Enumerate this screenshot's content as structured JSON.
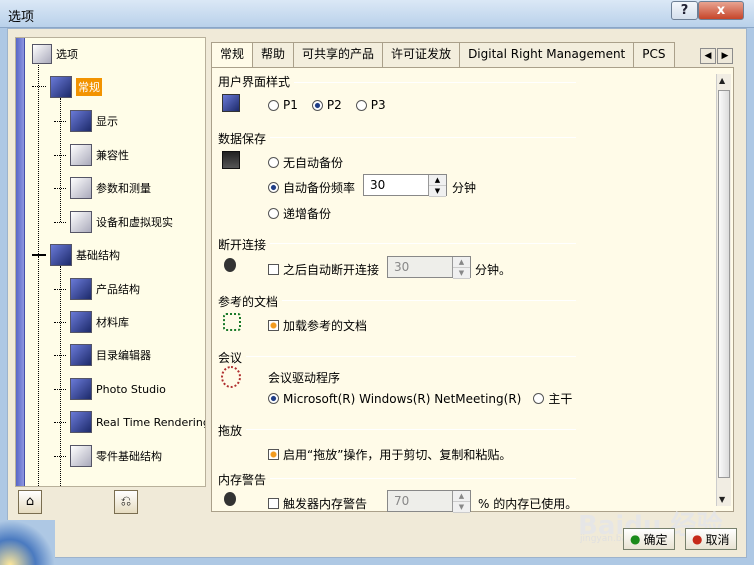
{
  "window": {
    "title": "选项",
    "help_label": "?",
    "close_label": "x"
  },
  "tree": {
    "root": "选项",
    "items": [
      {
        "label": "常规",
        "selected": true
      },
      {
        "label": "显示"
      },
      {
        "label": "兼容性"
      },
      {
        "label": "参数和测量"
      },
      {
        "label": "设备和虚拟现实"
      },
      {
        "label": "基础结构"
      },
      {
        "label": "产品结构"
      },
      {
        "label": "材料库"
      },
      {
        "label": "目录编辑器"
      },
      {
        "label": "Photo Studio"
      },
      {
        "label": "Real Time Rendering"
      },
      {
        "label": "零件基础结构"
      }
    ]
  },
  "tabs": [
    {
      "label": "常规",
      "active": true
    },
    {
      "label": "帮助"
    },
    {
      "label": "可共享的产品"
    },
    {
      "label": "许可证发放"
    },
    {
      "label": "Digital Right Management"
    },
    {
      "label": "PCS"
    }
  ],
  "sections": {
    "ui_style": {
      "title": "用户界面样式",
      "options": [
        "P1",
        "P2",
        "P3"
      ],
      "selected": "P2"
    },
    "data_save": {
      "title": "数据保存",
      "opt_none": "无自动备份",
      "opt_freq": "自动备份频率",
      "freq_value": "30",
      "freq_unit": "分钟",
      "opt_incr": "递增备份"
    },
    "disconnect": {
      "title": "断开连接",
      "label": "之后自动断开连接",
      "value": "30",
      "unit": "分钟。"
    },
    "ref_docs": {
      "title": "参考的文档",
      "label": "加载参考的文档"
    },
    "conference": {
      "title": "会议",
      "driver_label": "会议驱动程序",
      "opt1": "Microsoft(R) Windows(R) NetMeeting(R)",
      "opt2": "主干"
    },
    "drag": {
      "title": "拖放",
      "label": "启用“拖放”操作，用于剪切、复制和粘贴。"
    },
    "memory": {
      "title": "内存警告",
      "label": "触发器内存警告",
      "value": "70",
      "unit": "% 的内存已使用。"
    }
  },
  "buttons": {
    "ok": "确定",
    "cancel": "取消"
  },
  "watermark": {
    "brand": "Baidu 经验",
    "url": "jingyan.baidu.com"
  },
  "colors": {
    "selection": "#f29300",
    "tree_bar": "#5866c6",
    "close": "#c6452a"
  }
}
